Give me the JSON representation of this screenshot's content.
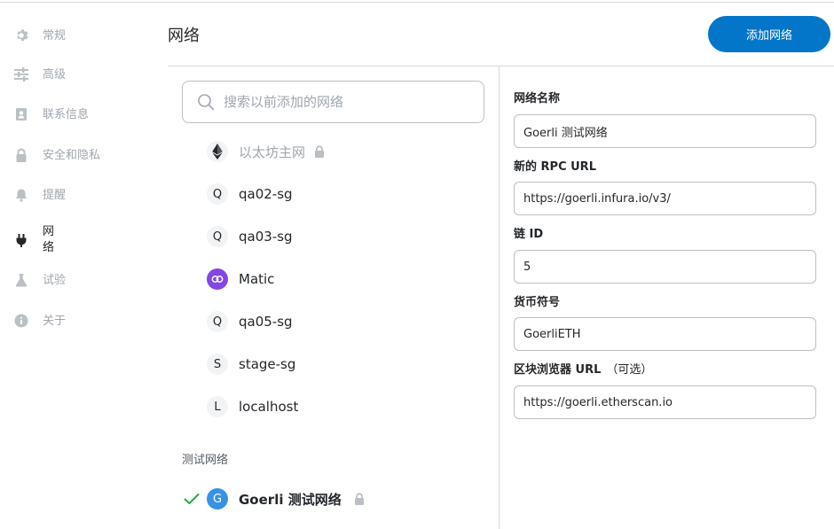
{
  "sidebar": {
    "items": [
      {
        "label": "常规",
        "icon": "gear-icon"
      },
      {
        "label": "高级",
        "icon": "sliders-icon"
      },
      {
        "label": "联系信息",
        "icon": "contact-book-icon"
      },
      {
        "label": "安全和隐私",
        "icon": "lock-icon"
      },
      {
        "label": "提醒",
        "icon": "bell-icon"
      },
      {
        "label": "网络",
        "icon": "plug-icon",
        "active": true
      },
      {
        "label": "试验",
        "icon": "flask-icon"
      },
      {
        "label": "关于",
        "icon": "info-icon"
      }
    ]
  },
  "header": {
    "title": "网络",
    "add_button": "添加网络"
  },
  "search": {
    "placeholder": "搜索以前添加的网络"
  },
  "networks": [
    {
      "name": "以太坊主网",
      "avatar": "ethereum-icon",
      "locked": true
    },
    {
      "name": "qa02-sg",
      "avatar": "Q"
    },
    {
      "name": "qa03-sg",
      "avatar": "Q"
    },
    {
      "name": "Matic",
      "avatar": "polygon-icon"
    },
    {
      "name": "qa05-sg",
      "avatar": "Q"
    },
    {
      "name": "stage-sg",
      "avatar": "S"
    },
    {
      "name": "localhost",
      "avatar": "L"
    }
  ],
  "test_networks": {
    "label": "测试网络",
    "selected": {
      "name": "Goerli 测试网络",
      "avatar": "G",
      "locked": true
    }
  },
  "form": {
    "network_name_label": "网络名称",
    "network_name_value": "Goerli 测试网络",
    "rpc_url_label": "新的 RPC URL",
    "rpc_url_value": "https://goerli.infura.io/v3/",
    "chain_id_label": "链 ID",
    "chain_id_value": "5",
    "currency_label": "货币符号",
    "currency_value": "GoerliETH",
    "explorer_label": "区块浏览器 URL",
    "explorer_optional": "（可选）",
    "explorer_value": "https://goerli.etherscan.io"
  },
  "colors": {
    "accent": "#0376c9",
    "success": "#28a745",
    "goerli_avatar": "#3693e4",
    "matic_avatar": "#8247e5",
    "muted_icon": "#bbc0c5"
  }
}
